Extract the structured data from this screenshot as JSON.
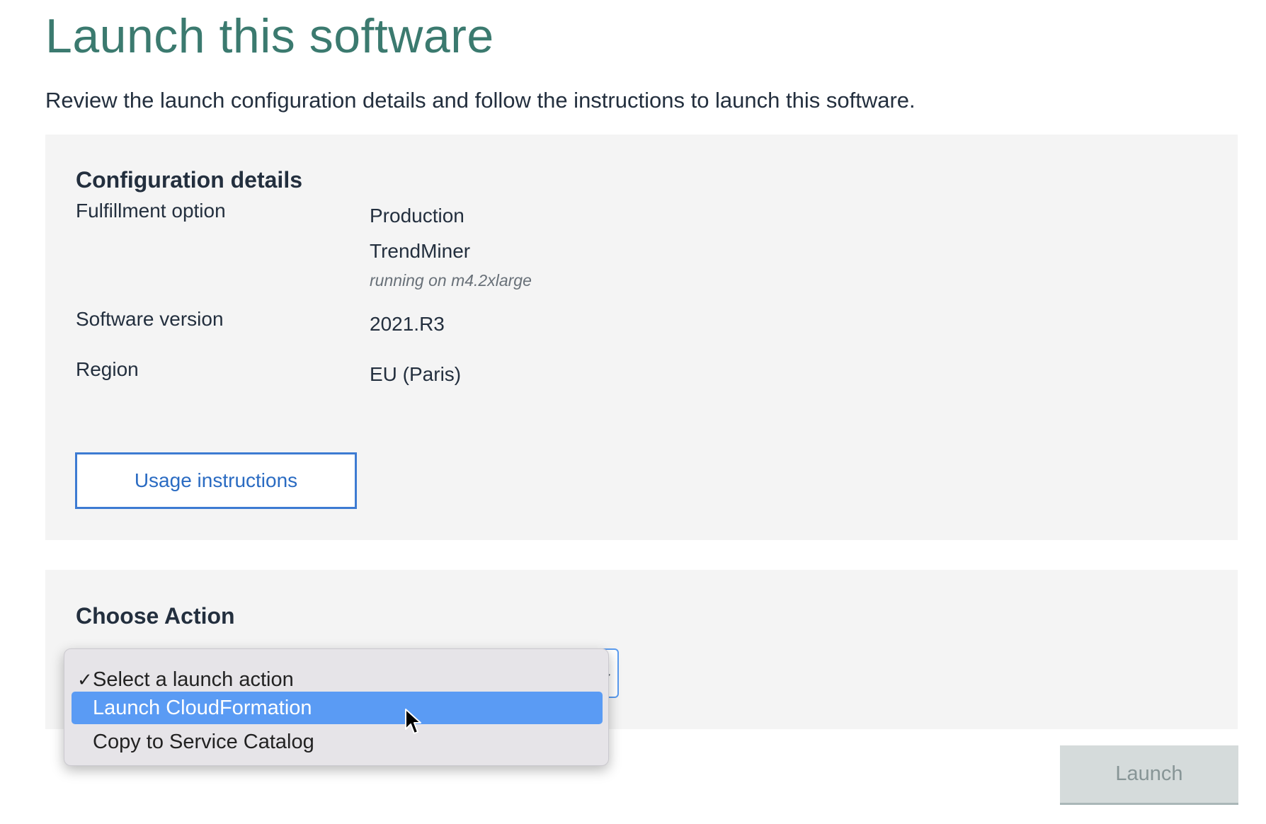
{
  "page": {
    "title": "Launch this software",
    "subtitle": "Review the launch configuration details and follow the instructions to launch this software."
  },
  "configuration": {
    "heading": "Configuration details",
    "fulfillment_label": "Fulfillment option",
    "fulfillment_value": "Production",
    "product_name": "TrendMiner",
    "instance_note": "running on m4.2xlarge",
    "version_label": "Software version",
    "version_value": "2021.R3",
    "region_label": "Region",
    "region_value": "EU (Paris)",
    "usage_button_label": "Usage instructions"
  },
  "action": {
    "heading": "Choose Action",
    "check_mark": "✓",
    "options": [
      "Select a launch action",
      "Launch CloudFormation",
      "Copy to Service Catalog"
    ],
    "checked_option": "Select a launch action",
    "highlighted_option": "Launch CloudFormation",
    "launch_button_label": "Launch",
    "launch_button_enabled": false
  },
  "colors": {
    "title": "#3b7a6f",
    "panel_background": "#f4f4f4",
    "link_blue": "#2a6bc2",
    "menu_highlight": "#5a9bf4",
    "disabled_button": "#d5dbdb"
  },
  "icons": {
    "check": "check-icon",
    "chevron": "chevron-down-icon",
    "cursor": "mouse-pointer-icon"
  }
}
